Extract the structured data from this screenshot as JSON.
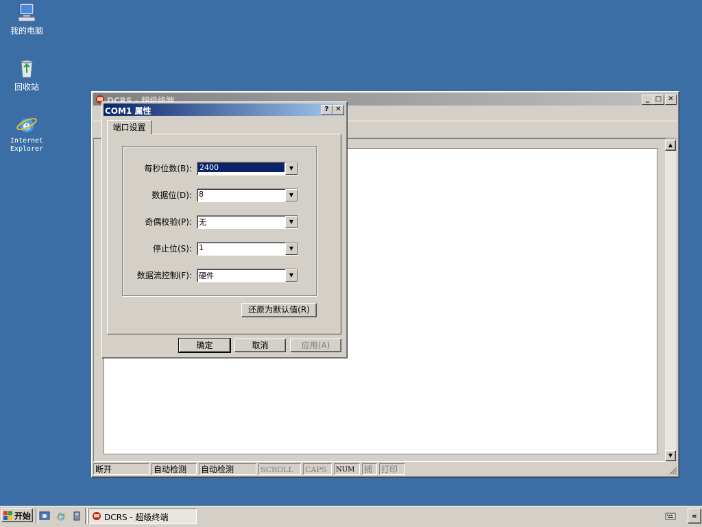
{
  "desktop": {
    "icons": [
      {
        "label": "我的电脑"
      },
      {
        "label": "回收站"
      },
      {
        "label": "Internet Explorer"
      }
    ]
  },
  "app_window": {
    "title": "DCRS - 超级终端",
    "status_bar": [
      "断开",
      "自动检测",
      "自动检测",
      "SCROLL",
      "CAPS",
      "NUM",
      "捕",
      "打印"
    ]
  },
  "dialog": {
    "title": "COM1 属性",
    "help_btn": "?",
    "close_btn": "✕",
    "tab": "端口设置",
    "fields": [
      {
        "label": "每秒位数(B):",
        "value": "2400"
      },
      {
        "label": "数据位(D):",
        "value": "8"
      },
      {
        "label": "奇偶校验(P):",
        "value": "无"
      },
      {
        "label": "停止位(S):",
        "value": "1"
      },
      {
        "label": "数据流控制(F):",
        "value": "硬件"
      }
    ],
    "restore_btn": "还原为默认值(R)",
    "ok_btn": "确定",
    "cancel_btn": "取消",
    "apply_btn": "应用(A)"
  },
  "taskbar": {
    "start": "开始",
    "task": "DCRS - 超级终端",
    "tray_btn": "«"
  }
}
